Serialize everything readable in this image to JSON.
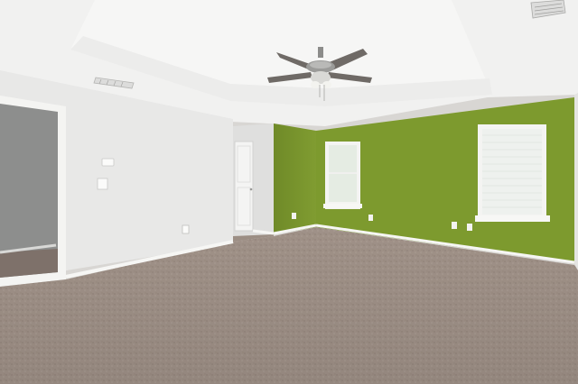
{
  "scene": {
    "colors": {
      "ceiling": "#f3f3f2",
      "tray_ceiling": "#f7f7f6",
      "white_wall": "#e9e9e8",
      "green_wall": "#7e9a2f",
      "green_wall_dark": "#6f8a28",
      "carpet": "#a8998f",
      "trim": "#f4f4f2",
      "dark_room": "#8e8f8e"
    },
    "icons": [
      "ceiling-fan-icon",
      "air-vent-icon",
      "outlet-icon",
      "thermostat-icon"
    ]
  }
}
